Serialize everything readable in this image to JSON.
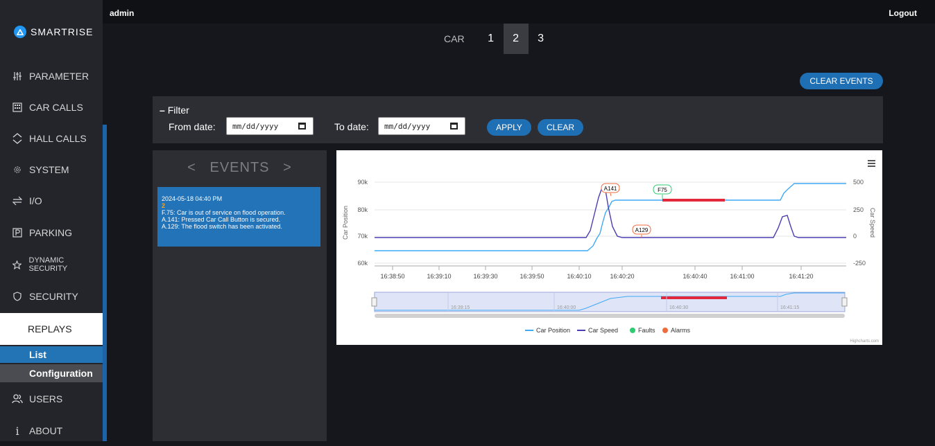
{
  "topbar": {
    "user": "admin",
    "logout": "Logout"
  },
  "sidebar": {
    "logo": "SMARTRISE",
    "items": [
      {
        "label": "PARAMETER",
        "icon": "sliders-icon"
      },
      {
        "label": "CAR CALLS",
        "icon": "keypad-icon"
      },
      {
        "label": "HALL CALLS",
        "icon": "up-down-chevron-icon"
      },
      {
        "label": "SYSTEM",
        "icon": "gear-icon"
      },
      {
        "label": "I/O",
        "icon": "swap-arrows-icon"
      },
      {
        "label": "PARKING",
        "icon": "parking-icon"
      },
      {
        "label": "DYNAMIC SECURITY",
        "icon": "star-icon"
      },
      {
        "label": "SECURITY",
        "icon": "shield-icon"
      }
    ],
    "replays": "REPLAYS",
    "sub_list": "List",
    "sub_config": "Configuration",
    "users": "USERS",
    "about": "ABOUT"
  },
  "carsel": {
    "label": "CAR",
    "cars": [
      "1",
      "2",
      "3"
    ],
    "active": "2"
  },
  "clear_events": "CLEAR EVENTS",
  "filter": {
    "title": "Filter",
    "from_label": "From date:",
    "to_label": "To date:",
    "from_placeholder": "mm/dd/yyyy",
    "to_placeholder": "mm/dd/yyyy",
    "apply": "APPLY",
    "clear": "CLEAR"
  },
  "events": {
    "header": "<   EVENTS   >",
    "card": {
      "timestamp": "2024-05-18 04:40 PM",
      "car": "2",
      "lines": [
        "F.75: Car is out of service on flood operation.",
        "A.141: Pressed Car Call Button is secured.",
        "A.129: The flood switch has been activated."
      ]
    }
  },
  "chart_data": {
    "type": "line",
    "x_ticks": [
      "16:38:50",
      "16:39:10",
      "16:39:30",
      "16:39:50",
      "16:40:10",
      "16:40:20",
      "16:40:40",
      "16:41:00",
      "16:41:20"
    ],
    "yleft_ticks": [
      "90k",
      "80k",
      "70k",
      "60k"
    ],
    "yright_ticks": [
      "500",
      "250",
      "0",
      "-250"
    ],
    "ylabel_left": "Car Position",
    "ylabel_right": "Car Speed",
    "yleft_lim": [
      60000,
      90000
    ],
    "yright_lim": [
      -250,
      500
    ],
    "series": [
      {
        "name": "Car Position",
        "color": "#3fa9f5"
      },
      {
        "name": "Car Speed",
        "color": "#4a3db0"
      },
      {
        "name": "Faults",
        "color": "#2ecc71"
      },
      {
        "name": "Alarms",
        "color": "#f06b3c"
      }
    ],
    "annotations": [
      "A141",
      "F75",
      "A129"
    ],
    "navigator_ticks": [
      "16:39:15",
      "16:40:00",
      "16:40:30",
      "16:41:15"
    ],
    "credit": "Highcharts.com",
    "menu_icon": "hamburger-icon"
  }
}
